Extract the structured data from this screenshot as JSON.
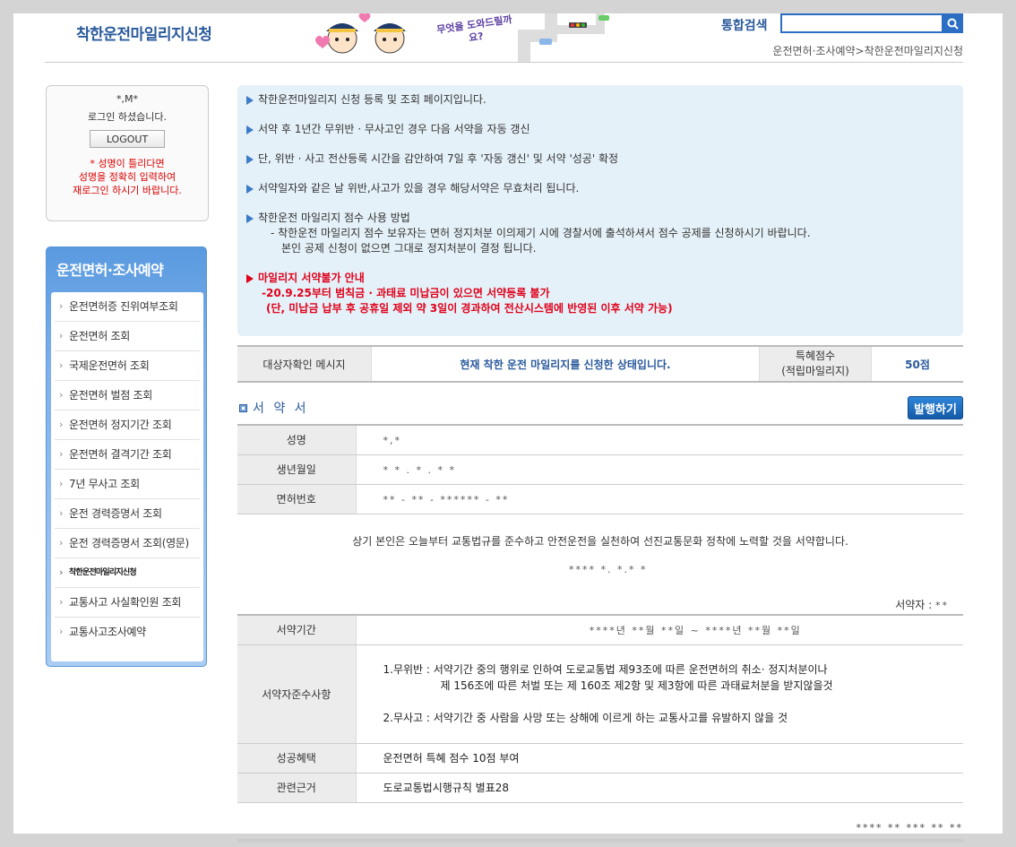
{
  "header": {
    "site_title": "착한운전마일리지신청",
    "banner_text": "무엇을 도와드릴까요?",
    "search_label": "통합검색",
    "search_value": "",
    "breadcrumb": "운전면허·조사예약>착한운전마일리지신청"
  },
  "login": {
    "name": "*,M*",
    "message": "로그인 하셨습니다.",
    "logout_label": "LOGOUT",
    "warn_line1": "* 성명이 틀리다면",
    "warn_line2": "성명을 정확히 입력하여",
    "warn_line3": "재로그인 하시기 바랍니다."
  },
  "side_menu": {
    "title": "운전면허·조사예약",
    "items": [
      {
        "label": "운전면허증 진위여부조회"
      },
      {
        "label": "운전면허 조회"
      },
      {
        "label": "국제운전면허 조회"
      },
      {
        "label": "운전면허 벌점 조회"
      },
      {
        "label": "운전면허 정지기간 조회"
      },
      {
        "label": "운전면허 결격기간 조회"
      },
      {
        "label": "7년 무사고 조회"
      },
      {
        "label": "운전 경력증명서 조회"
      },
      {
        "label": "운전 경력증명서 조회(영문)"
      },
      {
        "label": "착한운전마일리지신청"
      },
      {
        "label": "교통사고 사실확인원 조회"
      },
      {
        "label": "교통사고조사예약"
      }
    ]
  },
  "info": {
    "line1": "착한운전마일리지 신청 등록 및 조회 페이지입니다.",
    "line2": "서약 후 1년간 무위반 · 무사고인 경우 다음 서약을 자동 갱신",
    "line3": "단, 위반 · 사고 전산등록 시간을 감안하여 7일 후 '자동 갱신' 및 서약 '성공' 확정",
    "line4": "서약일자와 같은 날 위반,사고가 있을 경우 해당서약은 무효처리 됩니다.",
    "line5": "착한운전 마일리지 점수 사용 방법",
    "line5_sub1": "- 착한운전 마일리지 점수 보유자는 면허 정지처분 이의제기 시에 경찰서에 출석하셔서 점수 공제를 신청하시기 바랍니다.",
    "line5_sub2": "본인 공제 신청이 없으면 그대로 정지처분이 결정 됩니다.",
    "line6": "마일리지 서약불가 안내",
    "line6_sub1": "-20.9.25부터 범칙금 · 과태료 미납금이 있으면 서약등록 불가",
    "line6_sub2": "(단, 미납금 납부 후 공휴일 제외 약 3일이 경과하여 전산시스템에 반영된 이후 서약 가능)"
  },
  "status": {
    "head": "대상자확인 메시지",
    "message": "현재 착한 운전 마일리지를 신청한 상태입니다.",
    "score_head_line1": "특혜점수",
    "score_head_line2": "(적립마일리지)",
    "score": "50점"
  },
  "pledge": {
    "title": "서 약 서",
    "issue_label": "발행하기",
    "rows": [
      {
        "head": "성명",
        "value": "*,*"
      },
      {
        "head": "생년월일",
        "value": "* * . * . *  *"
      },
      {
        "head": "면허번호",
        "value": "** - ** - ****** - **"
      }
    ],
    "text": "상기 본인은 오늘부터 교통법규를 준수하고 안전운전을 실천하여 선진교통문화 정착에 노력할 것을 서약합니다.",
    "date": "**** *. *.* *",
    "pledger_label": "서약자 :",
    "pledger_value": "**"
  },
  "terms": {
    "period_head": "서약기간",
    "period_value": "****년 **월 **일  ~  ****년 **월 **일",
    "rules_head": "서약자준수사항",
    "rule1_line1": "1.무위반 : 서약기간 중의 행위로 인하여 도로교통법 제93조에 따른 운전면허의 취소· 정지처분이나",
    "rule1_line2": "제 156조에 따른 처벌 또는 제 160조 제2항 및 제3항에 따른 과태료처분을 받지않을것",
    "rule2": "2.무사고 : 서약기간 중 사람을 사망 또는 상해에 이르게 하는 교통사고를 유발하지 않을 것",
    "benefit_head": "성공혜택",
    "benefit_value": "운전면허 특혜 점수 10점 부여",
    "basis_head": "관련근거",
    "basis_value": "도로교통법시행규칙 별표28"
  },
  "footer": {
    "text": "**** ** *** ** **"
  },
  "colors": {
    "accent": "#2a5a9c",
    "menu_blue": "#5a9ae0",
    "info_bg": "#e5f1f8",
    "warn_red": "#e0001a"
  }
}
